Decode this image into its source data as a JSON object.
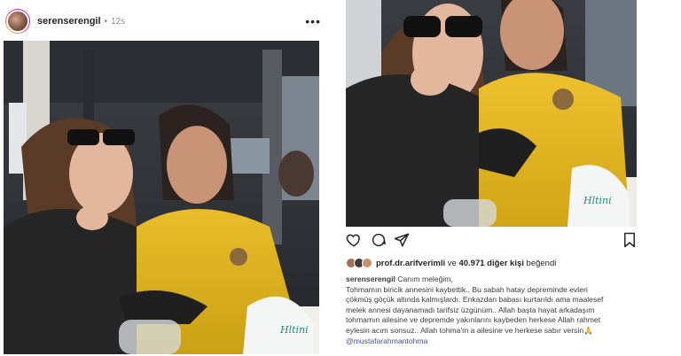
{
  "header": {
    "username": "serenserengil",
    "separator": "•",
    "time": "12s",
    "more": "•••"
  },
  "likes": {
    "liker": "prof.dr.arifverimli",
    "and": "ve",
    "count": "40.971 diğer kişi",
    "liked": "beğendi"
  },
  "caption": {
    "username": "serenserengil",
    "lines": [
      "Canım meleğim,",
      "Tohmamın biricik annesini kaybettik.. Bu sabah hatay depreminde evleri",
      "çökmüş göçük altında kalmışlardı. Enkazdan babası kurtarıldı ama maalesef",
      "melek annesi dayanamadı tarifsiz üzgünüm.. Allah başta hayat arkadaşım",
      "tohmamın ailesine ve depremde yakınlarını kaybeden herkese Allah rahmet",
      "eylesin acım sonsuz.. Allah tohma'm a ailesine ve herkese sabır versin🙏"
    ],
    "mention": "@mustafarahmantohma"
  },
  "colors": {
    "text": "#262626",
    "muted": "#8e8e8e",
    "mention": "#3f51a5",
    "sweater": "#e3b21c"
  },
  "icons": [
    "heart-icon",
    "comment-icon",
    "share-icon",
    "bookmark-icon",
    "more-icon"
  ]
}
